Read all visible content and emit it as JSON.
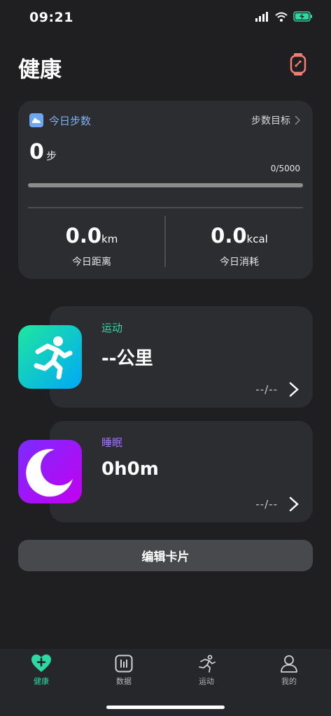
{
  "status_bar": {
    "time": "09:21"
  },
  "header": {
    "title": "健康"
  },
  "steps_card": {
    "title": "今日步数",
    "goal_link": "步数目标",
    "steps_value": "0",
    "steps_unit": "步",
    "progress_text": "0/5000",
    "progress_fraction": 0,
    "distance": {
      "value": "0.0",
      "unit": "km",
      "label": "今日距离"
    },
    "calories": {
      "value": "0.0",
      "unit": "kcal",
      "label": "今日消耗"
    }
  },
  "exercise_tile": {
    "category": "运动",
    "value": "--公里",
    "date": "--/--",
    "accent": "#3bd6a2"
  },
  "sleep_tile": {
    "category": "睡眠",
    "value": "0h0m",
    "date": "--/--",
    "accent": "#a073f5"
  },
  "edit_button": {
    "label": "编辑卡片"
  },
  "tab_bar": {
    "tabs": [
      {
        "label": "健康",
        "icon": "heart-plus-icon",
        "active": true
      },
      {
        "label": "数据",
        "icon": "chart-bars-icon",
        "active": false
      },
      {
        "label": "运动",
        "icon": "runner-icon",
        "active": false
      },
      {
        "label": "我的",
        "icon": "person-icon",
        "active": false
      }
    ]
  },
  "colors": {
    "background": "#1f1f21",
    "card": "#2c2d30",
    "accent": "#2ed8a3",
    "sleep_accent": "#a073f5",
    "watch": "#f07f73"
  }
}
